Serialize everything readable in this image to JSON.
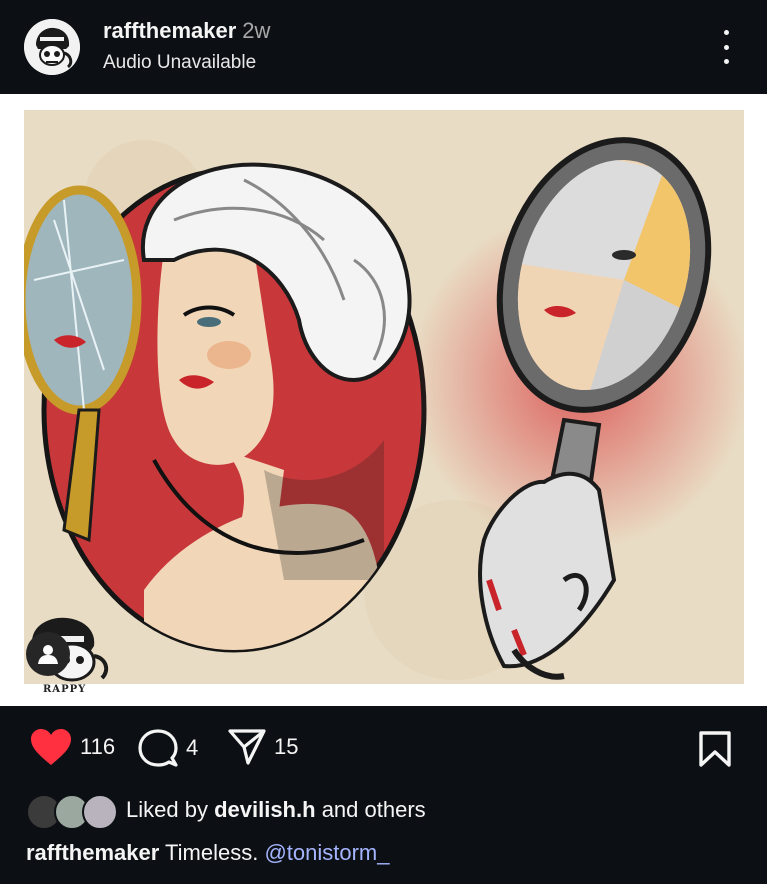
{
  "post": {
    "username": "raffthemaker",
    "time_ago": "2w",
    "audio_status": "Audio Unavailable"
  },
  "artwork": {
    "signature": "RAPPY"
  },
  "actions": {
    "likes": "116",
    "comments": "4",
    "shares": "15"
  },
  "likes_summary": {
    "prefix": "Liked by",
    "user": "devilish.h",
    "suffix": "and others"
  },
  "caption": {
    "username": "raffthemaker",
    "text": "Timeless.",
    "mention": "@tonistorm_"
  },
  "colors": {
    "background": "#0c1014",
    "like_red": "#ff3040",
    "mention": "#a5b4ff",
    "art_beige": "#e9dcc4",
    "art_red": "#c8383a"
  }
}
